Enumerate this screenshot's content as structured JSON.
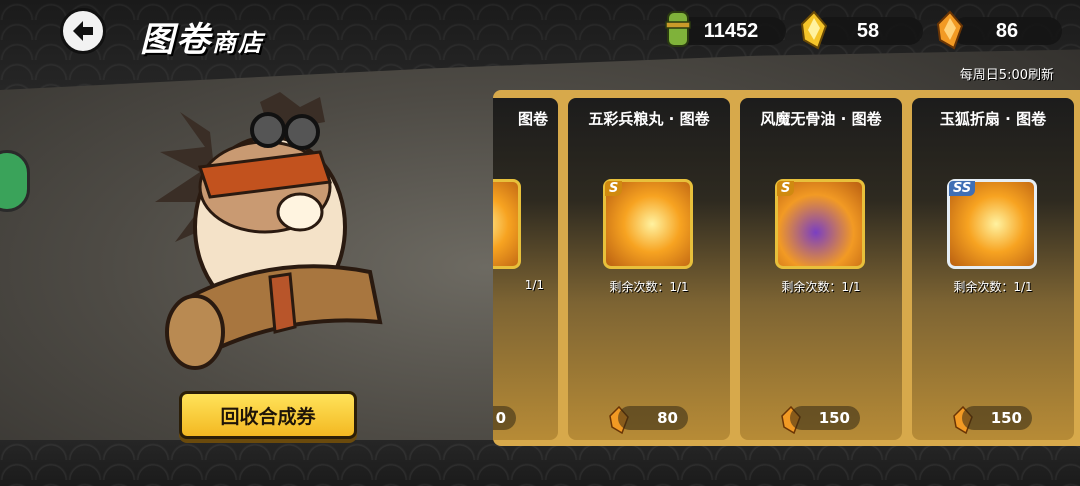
{
  "header": {
    "title_main": "图卷",
    "title_sub": "商店"
  },
  "resources": [
    {
      "icon": "scroll-bag-icon",
      "value": "11452"
    },
    {
      "icon": "gold-gem-icon",
      "value": "58"
    },
    {
      "icon": "orange-gem-icon",
      "value": "86"
    }
  ],
  "refresh_note": "每周日5:00刷新",
  "recycle_button": "回收合成券",
  "cards": [
    {
      "name": "图卷",
      "remain": "1/1",
      "price": "0",
      "partial": true
    },
    {
      "name": "五彩兵粮丸 · 图卷",
      "remain": "剩余次数：1/1",
      "price": "80",
      "grade": "S"
    },
    {
      "name": "风魔无骨油 · 图卷",
      "remain": "剩余次数：1/1",
      "price": "150",
      "grade": "S"
    },
    {
      "name": "玉狐折扇 · 图卷",
      "remain": "剩余次数：1/1",
      "price": "150",
      "grade": "SS"
    }
  ],
  "colors": {
    "panel": "#d7a94b",
    "button_yellow": "#f3b822",
    "s_grade": "#d08a10",
    "ss_grade": "#3f6fb5"
  }
}
